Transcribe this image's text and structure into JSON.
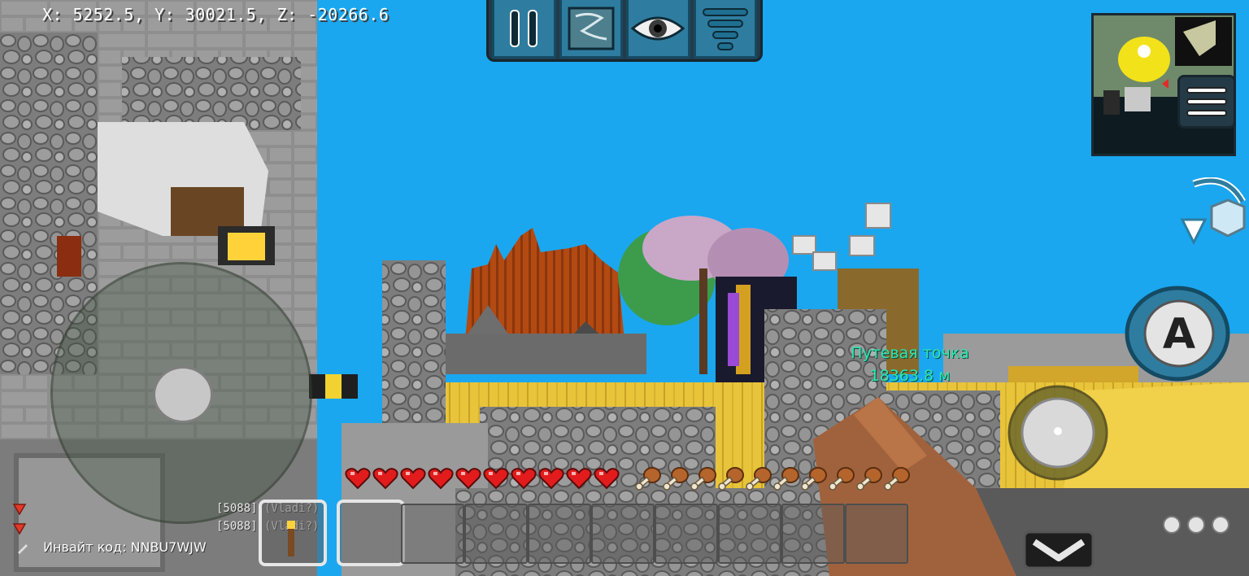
{
  "hud": {
    "coordinates": "X: 5252.5, Y: 30021.5, Z: -20266.6"
  },
  "toolbar": {
    "buttons": [
      {
        "icon": "pause-icon"
      },
      {
        "icon": "map-icon"
      },
      {
        "icon": "eye-icon"
      },
      {
        "icon": "menu-icon"
      }
    ]
  },
  "jump_button": {
    "label": "A"
  },
  "waypoint": {
    "title": "Путевая точка",
    "distance": "18363.8 м",
    "color": "#2fe6b0"
  },
  "status": {
    "health": 10,
    "health_max": 10,
    "hunger": 10,
    "hunger_max": 10
  },
  "hotbar": {
    "slot_count": 9,
    "selected_slot": 1,
    "offhand_item": "torch"
  },
  "chat": {
    "lines": [
      "[5088] (Vladi?)",
      "[5088] (Vladi?)"
    ]
  },
  "invite": {
    "text": "Инвайт код: NNBU7WJW"
  },
  "colors": {
    "sky": "#1aa7f0",
    "ui_panel": "#243a47",
    "ui_button": "#2e7da0",
    "heart": "#e21c1c",
    "wheat": "#e8c43a"
  }
}
